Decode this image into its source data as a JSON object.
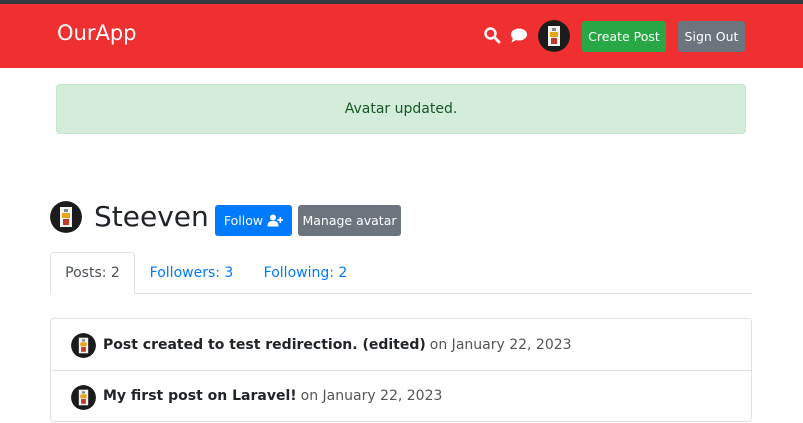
{
  "navbar": {
    "brand": "OurApp",
    "search_icon": "search-icon",
    "chat_icon": "chat-icon",
    "create_post_label": "Create Post",
    "sign_out_label": "Sign Out",
    "bg_color": "#f03030"
  },
  "alert": {
    "message": "Avatar updated."
  },
  "profile": {
    "username": "Steeven",
    "follow_label": "Follow",
    "follow_icon": "user-plus-icon",
    "manage_avatar_label": "Manage avatar"
  },
  "tabs": [
    {
      "label": "Posts: 2",
      "active": true
    },
    {
      "label": "Followers: 3",
      "active": false
    },
    {
      "label": "Following: 2",
      "active": false
    }
  ],
  "posts": [
    {
      "title": "Post created to test redirection. (edited)",
      "date_text": "on January 22, 2023"
    },
    {
      "title": "My first post on Laravel!",
      "date_text": "on January 22, 2023"
    }
  ]
}
